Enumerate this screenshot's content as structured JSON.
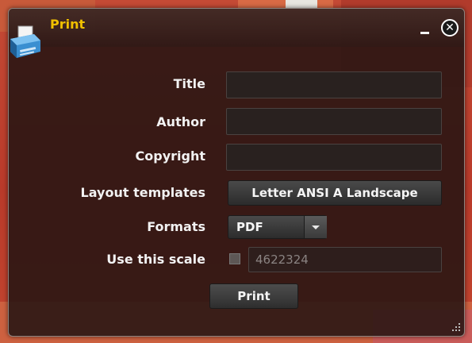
{
  "dialog": {
    "title": "Print",
    "icon": "printer-icon",
    "minimize_icon": "minimize-icon",
    "close_icon": "close-icon"
  },
  "form": {
    "title_label": "Title",
    "title_value": "",
    "author_label": "Author",
    "author_value": "",
    "copyright_label": "Copyright",
    "copyright_value": "",
    "layout_label": "Layout templates",
    "layout_value": "Letter ANSI A Landscape",
    "formats_label": "Formats",
    "formats_value": "PDF",
    "scale_label": "Use this scale",
    "scale_checked": false,
    "scale_value": "4622324",
    "print_label": "Print"
  },
  "colors": {
    "title_accent": "#f0c000",
    "dialog_bg": "#26140f",
    "map_backdrop": "#c1402a"
  }
}
